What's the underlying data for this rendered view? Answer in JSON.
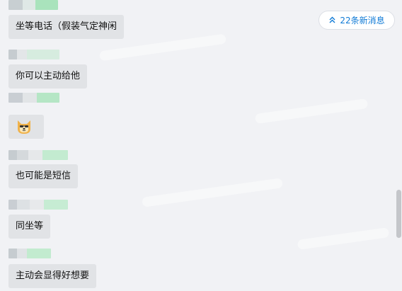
{
  "new_messages": {
    "label": "22条新消息",
    "accent": "#0f7ad6"
  },
  "messages": [
    {
      "kind": "text",
      "text": "坐等电话（假装气定神闲"
    },
    {
      "kind": "text",
      "text": "你可以主动给他"
    },
    {
      "kind": "emoji",
      "icon": "doge-emoji-icon"
    },
    {
      "kind": "text",
      "text": "也可能是短信"
    },
    {
      "kind": "text",
      "text": "同坐等"
    },
    {
      "kind": "text",
      "text": "主动会显得好想要"
    }
  ],
  "colors": {
    "background": "#f1f2f5",
    "bubble": "#e1e3e6",
    "text": "#111111"
  }
}
